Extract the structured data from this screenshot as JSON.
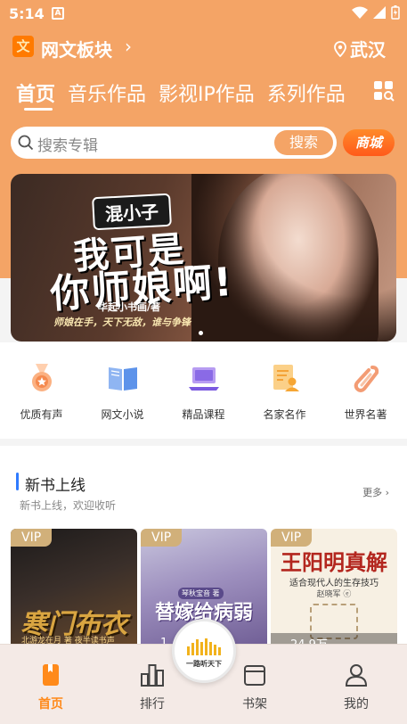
{
  "status_bar": {
    "time": "5:14",
    "notif_letter": "A"
  },
  "header": {
    "title": "网文板块",
    "chevron": "›",
    "location": "武汉",
    "logo_char": "文"
  },
  "tabs": [
    {
      "label": "首页",
      "active": true
    },
    {
      "label": "音乐作品",
      "active": false
    },
    {
      "label": "影视IP作品",
      "active": false
    },
    {
      "label": "系列作品",
      "active": false
    }
  ],
  "search": {
    "placeholder": "搜索专辑",
    "button_label": "搜索",
    "mall_label": "商城"
  },
  "banner": {
    "tag": "混小子",
    "headline_line1": "我可是",
    "headline_line2": "你师娘啊!",
    "author": "华起小书画/著",
    "slogan": "师娘在手，天下无敌，谁与争锋"
  },
  "categories": [
    {
      "label": "优质有声",
      "icon": "medal-icon"
    },
    {
      "label": "网文小说",
      "icon": "book-icon"
    },
    {
      "label": "精品课程",
      "icon": "laptop-icon"
    },
    {
      "label": "名家名作",
      "icon": "document-user-icon"
    },
    {
      "label": "世界名著",
      "icon": "paperclip-icon"
    }
  ],
  "section": {
    "title": "新书上线",
    "subtitle": "新书上线，欢迎收听",
    "more_label": "更多 ›"
  },
  "books": [
    {
      "badge": "VIP",
      "title": "寒门布衣",
      "subtitle": "北游龙在月 著 夜半读书声",
      "plays": ""
    },
    {
      "badge": "VIP",
      "title": "替嫁给病弱",
      "publisher": "琴秋宝音 著",
      "plays": "1"
    },
    {
      "badge": "VIP",
      "title": "王阳明真解",
      "line": "适合现代人的生存技巧",
      "author": "赵晓军 ⓔ",
      "plays": "24.9万"
    }
  ],
  "bottom_nav": [
    {
      "label": "首页",
      "active": true,
      "icon": "home-book-icon"
    },
    {
      "label": "排行",
      "active": false,
      "icon": "ranking-icon"
    },
    {
      "label": "书架",
      "active": false,
      "icon": "bookshelf-icon"
    },
    {
      "label": "我的",
      "active": false,
      "icon": "profile-icon"
    }
  ],
  "center_button": {
    "label": "一路听天下"
  },
  "colors": {
    "brand_orange": "#f4a466",
    "accent_orange": "#ff8a1a",
    "vip_gold": "#d1b07a",
    "section_bar_blue": "#2f7bff"
  }
}
